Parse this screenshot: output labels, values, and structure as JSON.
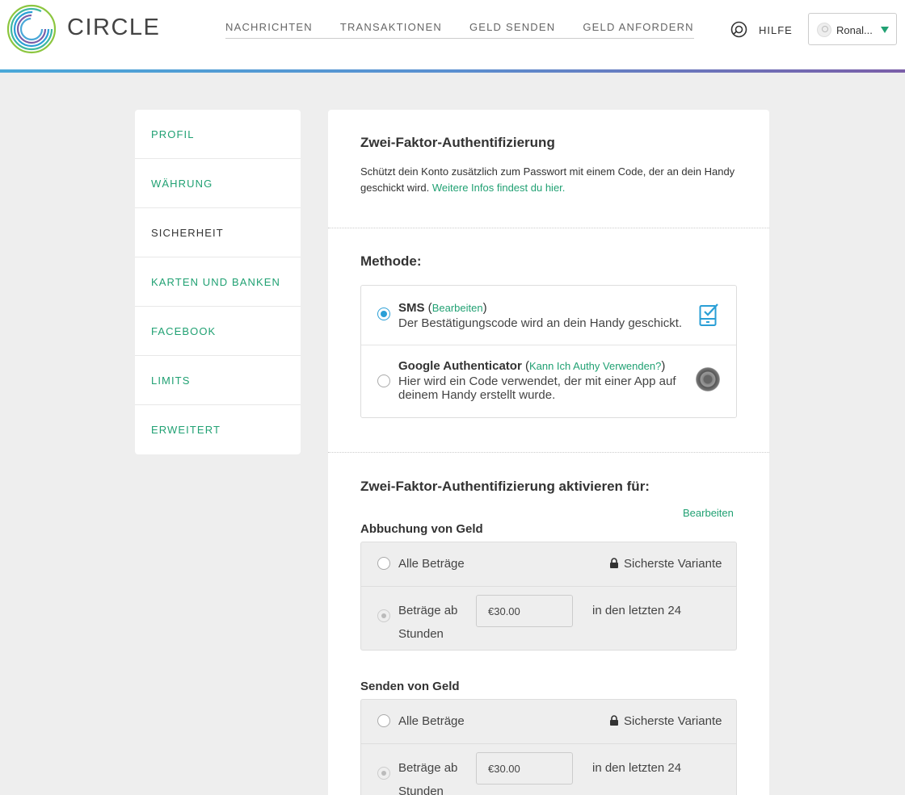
{
  "header": {
    "logo_text": "CIRCLE",
    "nav": [
      "NACHRICHTEN",
      "TRANSAKTIONEN",
      "GELD SENDEN",
      "GELD ANFORDERN"
    ],
    "help_label": "HILFE",
    "user_name": "Ronal...",
    "colors": {
      "accent": "#21a173",
      "header_line_start": "#4aa8d8",
      "header_line_end": "#7a5ea8"
    }
  },
  "sidebar": {
    "items": [
      {
        "label": "PROFIL",
        "active": false
      },
      {
        "label": "WÄHRUNG",
        "active": false
      },
      {
        "label": "SICHERHEIT",
        "active": true
      },
      {
        "label": "KARTEN UND BANKEN",
        "active": false
      },
      {
        "label": "FACEBOOK",
        "active": false
      },
      {
        "label": "LIMITS",
        "active": false
      },
      {
        "label": "ERWEITERT",
        "active": false
      }
    ]
  },
  "main": {
    "title": "Zwei-Faktor-Authentifizierung",
    "description": "Schützt dein Konto zusätzlich zum Passwort mit einem Code, der an dein Handy geschickt wird.",
    "info_link": "Weitere Infos findest du hier.",
    "method_heading": "Methode:",
    "methods": [
      {
        "name": "SMS",
        "link": "Bearbeiten",
        "subtitle": "Der Bestätigungscode wird an dein Handy geschickt.",
        "selected": true,
        "icon": "phone-check-icon"
      },
      {
        "name": "Google Authenticator",
        "link": "Kann Ich Authy Verwenden?",
        "subtitle_line1": "Hier wird ein Code verwendet, der mit einer App auf",
        "subtitle_line2": "deinem Handy erstellt wurde.",
        "selected": false,
        "icon": "google-authenticator-icon"
      }
    ],
    "activate_heading": "Zwei-Faktor-Authentifizierung aktivieren für:",
    "edit_label": "Bearbeiten",
    "groups": [
      {
        "label": "Abbuchung von Geld",
        "all_label": "Alle Beträge",
        "safest_label": "Sicherste Variante",
        "from_label": "Beträge ab",
        "from_label2": "Stunden",
        "amount": "€30.00",
        "period_label": "in den letzten 24"
      },
      {
        "label": "Senden von Geld",
        "all_label": "Alle Beträge",
        "safest_label": "Sicherste Variante",
        "from_label": "Beträge ab",
        "from_label2": "Stunden",
        "amount": "€30.00",
        "period_label": "in den letzten 24"
      }
    ]
  }
}
